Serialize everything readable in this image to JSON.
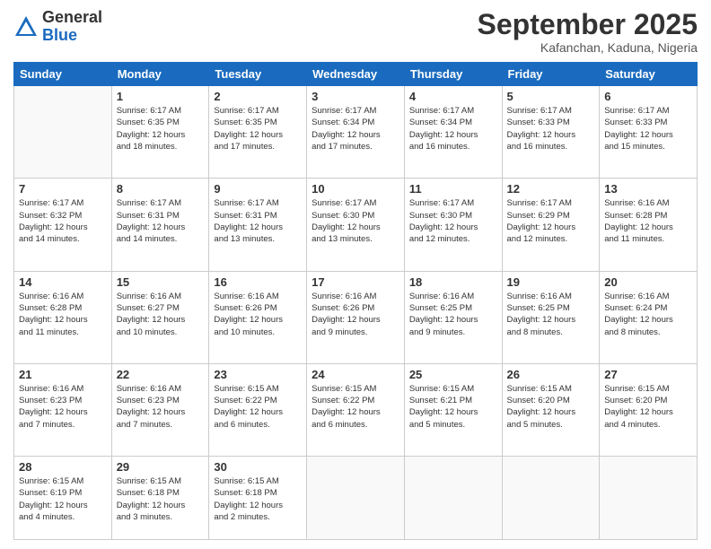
{
  "header": {
    "logo_general": "General",
    "logo_blue": "Blue",
    "month": "September 2025",
    "location": "Kafanchan, Kaduna, Nigeria"
  },
  "weekdays": [
    "Sunday",
    "Monday",
    "Tuesday",
    "Wednesday",
    "Thursday",
    "Friday",
    "Saturday"
  ],
  "weeks": [
    [
      {
        "day": "",
        "info": ""
      },
      {
        "day": "1",
        "info": "Sunrise: 6:17 AM\nSunset: 6:35 PM\nDaylight: 12 hours\nand 18 minutes."
      },
      {
        "day": "2",
        "info": "Sunrise: 6:17 AM\nSunset: 6:35 PM\nDaylight: 12 hours\nand 17 minutes."
      },
      {
        "day": "3",
        "info": "Sunrise: 6:17 AM\nSunset: 6:34 PM\nDaylight: 12 hours\nand 17 minutes."
      },
      {
        "day": "4",
        "info": "Sunrise: 6:17 AM\nSunset: 6:34 PM\nDaylight: 12 hours\nand 16 minutes."
      },
      {
        "day": "5",
        "info": "Sunrise: 6:17 AM\nSunset: 6:33 PM\nDaylight: 12 hours\nand 16 minutes."
      },
      {
        "day": "6",
        "info": "Sunrise: 6:17 AM\nSunset: 6:33 PM\nDaylight: 12 hours\nand 15 minutes."
      }
    ],
    [
      {
        "day": "7",
        "info": "Sunrise: 6:17 AM\nSunset: 6:32 PM\nDaylight: 12 hours\nand 14 minutes."
      },
      {
        "day": "8",
        "info": "Sunrise: 6:17 AM\nSunset: 6:31 PM\nDaylight: 12 hours\nand 14 minutes."
      },
      {
        "day": "9",
        "info": "Sunrise: 6:17 AM\nSunset: 6:31 PM\nDaylight: 12 hours\nand 13 minutes."
      },
      {
        "day": "10",
        "info": "Sunrise: 6:17 AM\nSunset: 6:30 PM\nDaylight: 12 hours\nand 13 minutes."
      },
      {
        "day": "11",
        "info": "Sunrise: 6:17 AM\nSunset: 6:30 PM\nDaylight: 12 hours\nand 12 minutes."
      },
      {
        "day": "12",
        "info": "Sunrise: 6:17 AM\nSunset: 6:29 PM\nDaylight: 12 hours\nand 12 minutes."
      },
      {
        "day": "13",
        "info": "Sunrise: 6:16 AM\nSunset: 6:28 PM\nDaylight: 12 hours\nand 11 minutes."
      }
    ],
    [
      {
        "day": "14",
        "info": "Sunrise: 6:16 AM\nSunset: 6:28 PM\nDaylight: 12 hours\nand 11 minutes."
      },
      {
        "day": "15",
        "info": "Sunrise: 6:16 AM\nSunset: 6:27 PM\nDaylight: 12 hours\nand 10 minutes."
      },
      {
        "day": "16",
        "info": "Sunrise: 6:16 AM\nSunset: 6:26 PM\nDaylight: 12 hours\nand 10 minutes."
      },
      {
        "day": "17",
        "info": "Sunrise: 6:16 AM\nSunset: 6:26 PM\nDaylight: 12 hours\nand 9 minutes."
      },
      {
        "day": "18",
        "info": "Sunrise: 6:16 AM\nSunset: 6:25 PM\nDaylight: 12 hours\nand 9 minutes."
      },
      {
        "day": "19",
        "info": "Sunrise: 6:16 AM\nSunset: 6:25 PM\nDaylight: 12 hours\nand 8 minutes."
      },
      {
        "day": "20",
        "info": "Sunrise: 6:16 AM\nSunset: 6:24 PM\nDaylight: 12 hours\nand 8 minutes."
      }
    ],
    [
      {
        "day": "21",
        "info": "Sunrise: 6:16 AM\nSunset: 6:23 PM\nDaylight: 12 hours\nand 7 minutes."
      },
      {
        "day": "22",
        "info": "Sunrise: 6:16 AM\nSunset: 6:23 PM\nDaylight: 12 hours\nand 7 minutes."
      },
      {
        "day": "23",
        "info": "Sunrise: 6:15 AM\nSunset: 6:22 PM\nDaylight: 12 hours\nand 6 minutes."
      },
      {
        "day": "24",
        "info": "Sunrise: 6:15 AM\nSunset: 6:22 PM\nDaylight: 12 hours\nand 6 minutes."
      },
      {
        "day": "25",
        "info": "Sunrise: 6:15 AM\nSunset: 6:21 PM\nDaylight: 12 hours\nand 5 minutes."
      },
      {
        "day": "26",
        "info": "Sunrise: 6:15 AM\nSunset: 6:20 PM\nDaylight: 12 hours\nand 5 minutes."
      },
      {
        "day": "27",
        "info": "Sunrise: 6:15 AM\nSunset: 6:20 PM\nDaylight: 12 hours\nand 4 minutes."
      }
    ],
    [
      {
        "day": "28",
        "info": "Sunrise: 6:15 AM\nSunset: 6:19 PM\nDaylight: 12 hours\nand 4 minutes."
      },
      {
        "day": "29",
        "info": "Sunrise: 6:15 AM\nSunset: 6:18 PM\nDaylight: 12 hours\nand 3 minutes."
      },
      {
        "day": "30",
        "info": "Sunrise: 6:15 AM\nSunset: 6:18 PM\nDaylight: 12 hours\nand 2 minutes."
      },
      {
        "day": "",
        "info": ""
      },
      {
        "day": "",
        "info": ""
      },
      {
        "day": "",
        "info": ""
      },
      {
        "day": "",
        "info": ""
      }
    ]
  ]
}
